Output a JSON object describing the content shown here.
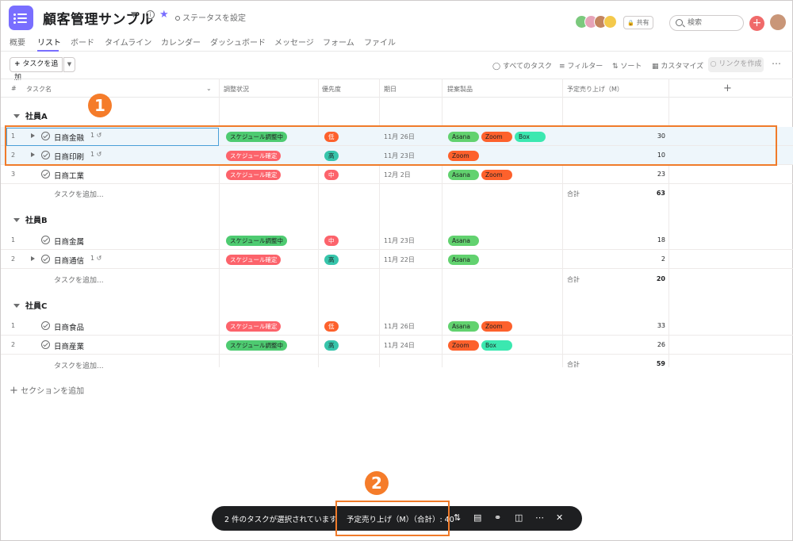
{
  "header": {
    "project_title": "顧客管理サンプル",
    "status_label": "ステータスを設定",
    "share_label": "共有",
    "search_placeholder": "検索"
  },
  "tabs": [
    "概要",
    "リスト",
    "ボード",
    "タイムライン",
    "カレンダー",
    "ダッシュボード",
    "メッセージ",
    "フォーム",
    "ファイル"
  ],
  "active_tab": "リスト",
  "toolbar": {
    "add_task": "タスクを追加",
    "all_tasks": "すべてのタスク",
    "filter": "フィルター",
    "sort": "ソート",
    "customize": "カスタマイズ",
    "create_link": "リンクを作成"
  },
  "columns": {
    "num": "#",
    "task_name": "タスク名",
    "status": "調整状況",
    "priority": "優先度",
    "date": "期日",
    "products": "提案製品",
    "sales": "予定売り上げ（M）"
  },
  "sections": [
    {
      "name": "社員A",
      "rows": [
        {
          "num": "1",
          "name": "日商金融",
          "subtasks": "1",
          "status": "スケジュール調整中",
          "priority": "低",
          "date": "11月 26日",
          "products": [
            "Asana",
            "Zoom",
            "Box"
          ],
          "sales": "30"
        },
        {
          "num": "2",
          "name": "日商印刷",
          "subtasks": "1",
          "status": "スケジュール確定",
          "priority": "高",
          "date": "11月 23日",
          "products": [
            "Zoom"
          ],
          "sales": "10"
        },
        {
          "num": "3",
          "name": "日商工業",
          "status": "スケジュール確定",
          "priority": "中",
          "date": "12月 2日",
          "products": [
            "Asana",
            "Zoom"
          ],
          "sales": "23"
        }
      ],
      "add_label": "タスクを追加...",
      "sum_label": "合計",
      "sum_value": "63"
    },
    {
      "name": "社員B",
      "rows": [
        {
          "num": "1",
          "name": "日商金属",
          "status": "スケジュール調整中",
          "priority": "中",
          "date": "11月 23日",
          "products": [
            "Asana"
          ],
          "sales": "18"
        },
        {
          "num": "2",
          "name": "日商通信",
          "subtasks": "1",
          "status": "スケジュール確定",
          "priority": "高",
          "date": "11月 22日",
          "products": [
            "Asana"
          ],
          "sales": "2"
        }
      ],
      "add_label": "タスクを追加...",
      "sum_label": "合計",
      "sum_value": "20"
    },
    {
      "name": "社員C",
      "rows": [
        {
          "num": "1",
          "name": "日商食品",
          "status": "スケジュール確定",
          "priority": "低",
          "date": "11月 26日",
          "products": [
            "Asana",
            "Zoom"
          ],
          "sales": "33"
        },
        {
          "num": "2",
          "name": "日商産業",
          "status": "スケジュール調整中",
          "priority": "高",
          "date": "11月 24日",
          "products": [
            "Zoom",
            "Box"
          ],
          "sales": "26"
        }
      ],
      "add_label": "タスクを追加...",
      "sum_label": "合計",
      "sum_value": "59"
    }
  ],
  "add_section": "セクションを追加",
  "callouts": [
    "1",
    "2"
  ],
  "action_bar": {
    "selected_count": "2 件のタスクが選択されています",
    "field_sum": "予定売り上げ（M）（合計）: 40"
  },
  "colors": {
    "accent": "#796eff",
    "highlight": "#f07b2a",
    "selected_row": "#eef6fb"
  }
}
